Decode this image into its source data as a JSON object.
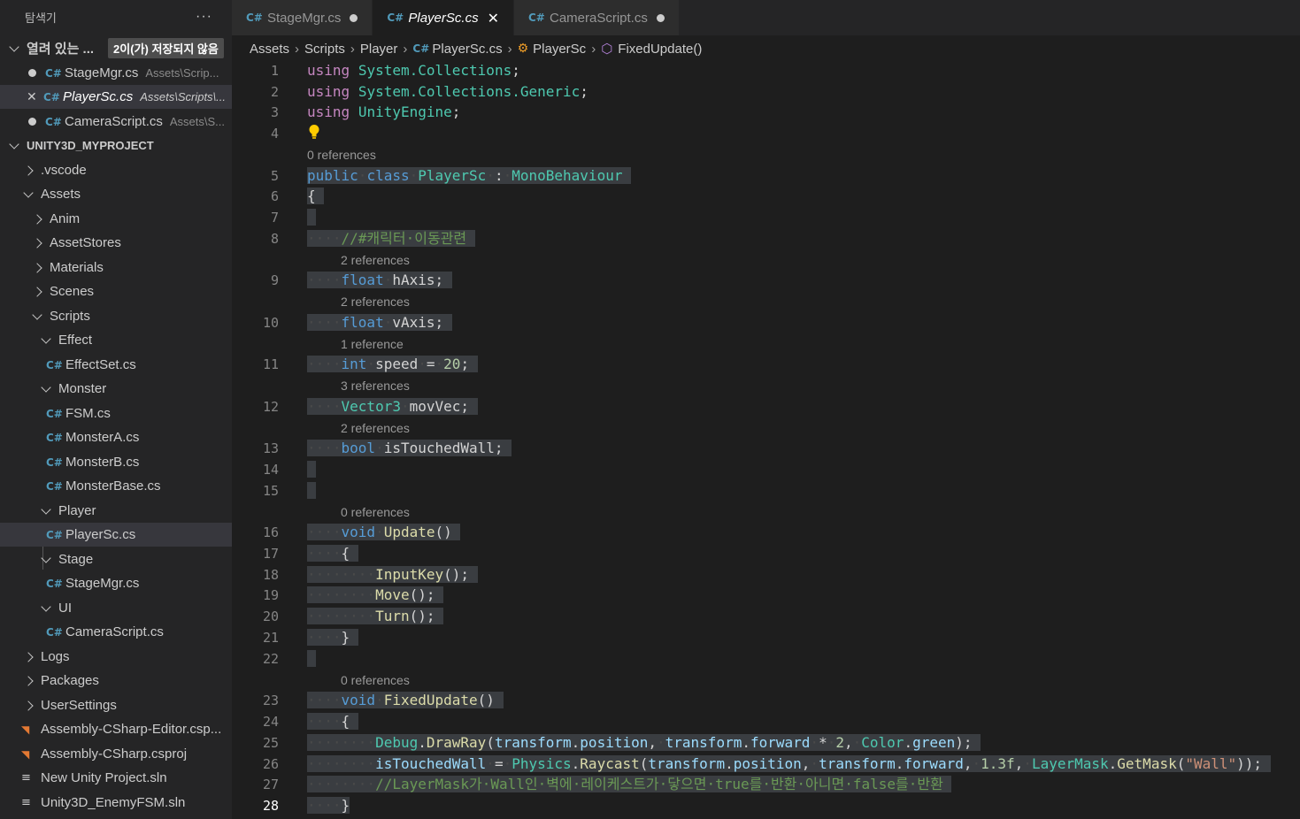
{
  "sidebar": {
    "title": "탐색기",
    "more": "···",
    "open_editors": {
      "label": "열려 있는 ...",
      "badge": "2이(가) 저장되지 않음",
      "items": [
        {
          "name": "StageMgr.cs",
          "path": "Assets\\Scrip..."
        },
        {
          "name": "PlayerSc.cs",
          "path": "Assets\\Scripts\\..."
        },
        {
          "name": "CameraScript.cs",
          "path": "Assets\\S..."
        }
      ]
    },
    "project": {
      "label": "UNITY3D_MYPROJECT",
      "items": [
        ".vscode",
        "Assets",
        "Anim",
        "AssetStores",
        "Materials",
        "Scenes",
        "Scripts",
        "Effect",
        "EffectSet.cs",
        "Monster",
        "FSM.cs",
        "MonsterA.cs",
        "MonsterB.cs",
        "MonsterBase.cs",
        "Player",
        "PlayerSc.cs",
        "Stage",
        "StageMgr.cs",
        "UI",
        "CameraScript.cs",
        "Logs",
        "Packages",
        "UserSettings",
        "Assembly-CSharp-Editor.csp...",
        "Assembly-CSharp.csproj",
        "New Unity Project.sln",
        "Unity3D_EnemyFSM.sln"
      ]
    }
  },
  "tabs": [
    {
      "label": "StageMgr.cs",
      "dirty": true
    },
    {
      "label": "PlayerSc.cs",
      "active": true
    },
    {
      "label": "CameraScript.cs",
      "dirty": true
    }
  ],
  "breadcrumb": [
    "Assets",
    "Scripts",
    "Player",
    "PlayerSc.cs",
    "PlayerSc",
    "FixedUpdate()"
  ],
  "code": {
    "line_numbers": [
      "1",
      "2",
      "3",
      "4",
      "5",
      "6",
      "7",
      "8",
      "9",
      "10",
      "11",
      "12",
      "13",
      "14",
      "15",
      "16",
      "17",
      "18",
      "19",
      "20",
      "21",
      "22",
      "23",
      "24",
      "25",
      "26",
      "27",
      "28"
    ],
    "references": {
      "class": "0 references",
      "hAxis": "2 references",
      "vAxis": "2 references",
      "speed": "1 reference",
      "movVec": "3 references",
      "isTouchedWall": "2 references",
      "update": "0 references",
      "fixedUpdate": "0 references"
    },
    "tokens": {
      "using": "using",
      "ns_collections": "System.Collections",
      "ns_generic": "System.Collections.Generic",
      "ns_unity": "UnityEngine",
      "semi": ";",
      "public": "public",
      "class": "class",
      "class_name": "PlayerSc",
      "colon": ":",
      "base": "MonoBehaviour",
      "open_brace": "{",
      "close_brace": "}",
      "comment1": "//#캐릭터·이동관련",
      "float": "float",
      "hAxis": "hAxis;",
      "vAxis": "vAxis;",
      "int": "int",
      "speed": "speed",
      "eq": "=",
      "twenty": "20",
      "vector3": "Vector3",
      "movVec": "movVec;",
      "bool": "bool",
      "isTouchedWall": "isTouchedWall;",
      "void": "void",
      "update": "Update",
      "parens": "()",
      "inputKey": "InputKey",
      "move": "Move",
      "turn": "Turn",
      "call_end": "();",
      "fixedUpdate": "FixedUpdate",
      "debug": "Debug",
      "drawRay": "DrawRay",
      "transform": "transform",
      "position": "position",
      "forward": "forward",
      "two": "2",
      "color": "Color",
      "green": "green",
      "isTouchedWallVar": "isTouchedWall",
      "physics": "Physics",
      "raycast": "Raycast",
      "onePointThree": "1.3f",
      "layerMask": "LayerMask",
      "getMask": "GetMask",
      "wall": "\"Wall\"",
      "comment2": "//LayerMask가·Wall인·벽에·레이케스트가·닿으면·true를·반환·아니면·false를·반환"
    }
  },
  "colors": {
    "editor_bg": "#1e1e1e",
    "sidebar_bg": "#252526",
    "keyword": "#569cd6",
    "type": "#4ec9b0",
    "function": "#dcdcaa",
    "variable": "#9cdcfe",
    "comment": "#6a9955",
    "string": "#ce9178",
    "number": "#b5cea8"
  }
}
